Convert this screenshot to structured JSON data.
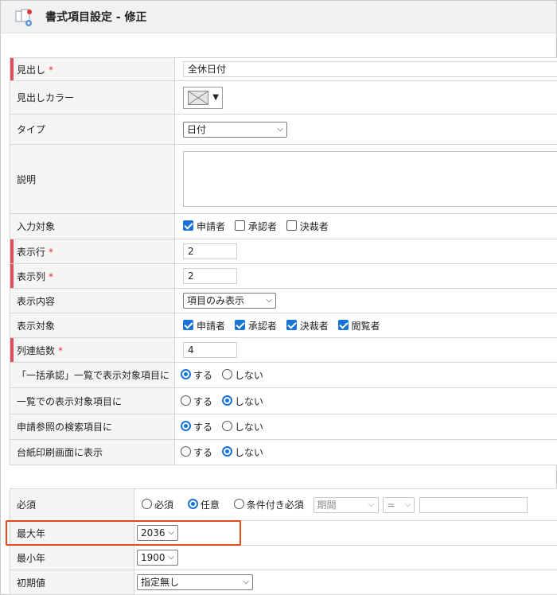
{
  "header": {
    "title": "書式項目設定 - 修正",
    "icon": "form-settings-icon"
  },
  "fields": {
    "heading": {
      "label": "見出し",
      "required_mark": "*",
      "value": "全休日付"
    },
    "heading_color": {
      "label": "見出しカラー",
      "value_icon": "no-color-icon"
    },
    "type": {
      "label": "タイプ",
      "value": "日付"
    },
    "description": {
      "label": "説明",
      "value": ""
    },
    "input_target": {
      "label": "入力対象",
      "options": [
        {
          "label": "申請者",
          "checked": true
        },
        {
          "label": "承認者",
          "checked": false
        },
        {
          "label": "決裁者",
          "checked": false
        }
      ]
    },
    "display_row": {
      "label": "表示行",
      "required_mark": "*",
      "value": "2"
    },
    "display_col": {
      "label": "表示列",
      "required_mark": "*",
      "value": "2"
    },
    "display_content": {
      "label": "表示内容",
      "value": "項目のみ表示"
    },
    "display_target": {
      "label": "表示対象",
      "options": [
        {
          "label": "申請者",
          "checked": true
        },
        {
          "label": "承認者",
          "checked": true
        },
        {
          "label": "決裁者",
          "checked": true
        },
        {
          "label": "閲覧者",
          "checked": true
        }
      ]
    },
    "col_span": {
      "label": "列連結数",
      "required_mark": "*",
      "value": "4"
    },
    "bulk_approve": {
      "label": "「一括承認」一覧で表示対象項目に",
      "yes": "する",
      "no": "しない",
      "selected": "yes"
    },
    "list_display": {
      "label": "一覧での表示対象項目に",
      "yes": "する",
      "no": "しない",
      "selected": "no"
    },
    "search_item": {
      "label": "申請参照の検索項目に",
      "yes": "する",
      "no": "しない",
      "selected": "yes"
    },
    "print_display": {
      "label": "台紙印刷画面に表示",
      "yes": "する",
      "no": "しない",
      "selected": "no"
    }
  },
  "date_fields": {
    "required": {
      "label": "必須",
      "options": [
        "必須",
        "任意",
        "条件付き必須"
      ],
      "selected": "任意",
      "cond_field_placeholder": "期間",
      "cond_op": "=",
      "cond_value": ""
    },
    "max_year": {
      "label": "最大年",
      "value": "2036"
    },
    "min_year": {
      "label": "最小年",
      "value": "1900"
    },
    "initial": {
      "label": "初期値",
      "value": "指定無し"
    }
  },
  "colors": {
    "accent": "#1a73d6",
    "required_bar": "#e0505a",
    "highlight": "#e64a19"
  }
}
